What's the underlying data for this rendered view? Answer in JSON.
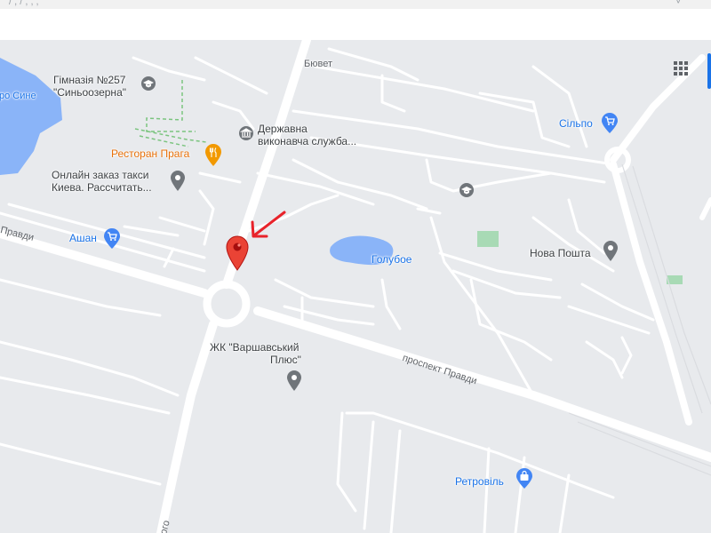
{
  "top_strip": {
    "text": "/ ,   /  ,   , ,  ",
    "caret": "˅"
  },
  "map": {
    "labels": {
      "gymnasium": {
        "line1": "Гімназія №257",
        "line2": "\"Синьоозерна\""
      },
      "state_service": {
        "line1": "Державна",
        "line2": "виконавча служба..."
      },
      "restaurant": "Ресторан Прага",
      "taxi": {
        "line1": "Онлайн заказ такси",
        "line2": "Киева. Рассчитать..."
      },
      "auchan": "Ашан",
      "silpo": "Сільпо",
      "nova_poshta": "Нова Пошта",
      "lake": "Голубое",
      "residential": {
        "line1": "ЖК \"Варшавський",
        "line2": "Плюс\""
      },
      "retroville": "Ретровіль",
      "buvet": "Бювет",
      "lake_partial": "ро Сине",
      "street_pravdy": "проспект Правди",
      "street_left": "Правди",
      "street_bottom": "ого"
    },
    "icons": [
      "school-icon",
      "government-icon",
      "restaurant-icon",
      "place-icon",
      "shopping-cart-icon",
      "post-office-icon",
      "shopping-bag-icon",
      "apps-grid-icon",
      "map-pin-icon",
      "red-arrow"
    ],
    "colors": {
      "background": "#e8eaed",
      "road": "#ffffff",
      "water": "#8ab4f8",
      "park": "#a8dab5",
      "poi_gray": "#70757a",
      "poi_blue": "#4285f4",
      "poi_orange": "#f29900",
      "marker": "#ea4335",
      "arrow": "#e8232b"
    }
  }
}
